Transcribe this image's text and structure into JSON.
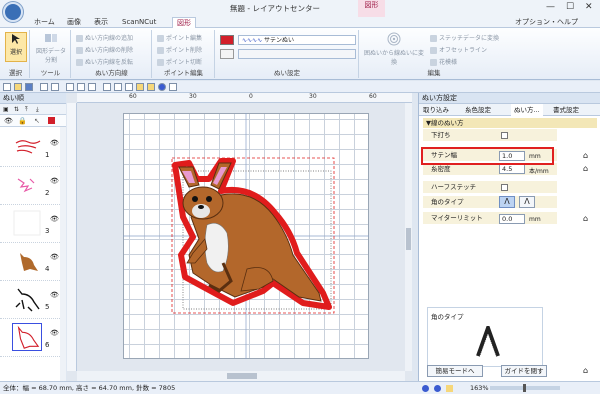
{
  "window": {
    "title": "無題 - レイアウトセンター",
    "context_tab": "図形",
    "minimize": "—",
    "maximize": "☐",
    "close": "✕"
  },
  "menu": {
    "tabs": [
      "ホーム",
      "画像",
      "表示",
      "ScanNCut",
      "図形"
    ],
    "right": "オプション・ヘルプ"
  },
  "ribbon": {
    "select": {
      "label": "選択",
      "group": "選択"
    },
    "tools": {
      "label": "図形データ分割",
      "group": "ツール"
    },
    "direction": {
      "items": [
        "ぬい方向線の追加",
        "ぬい方向線の削除",
        "ぬい方向線を反転"
      ],
      "group": "ぬい方向線"
    },
    "point": {
      "items": [
        "ポイント編集",
        "ポイント削除",
        "ポイント切断"
      ],
      "group": "ポイント編集"
    },
    "sewing": {
      "line_value": "サテンぬい",
      "group": "ぬい設定"
    },
    "edit": {
      "big_label": "囲ぬいから線ぬいに変換",
      "items": [
        "ステッチデータに変換",
        "オフセットライン",
        "花模様"
      ],
      "group": "編集"
    }
  },
  "left_panel": {
    "title": "ぬい順",
    "items": [
      {
        "num": "1"
      },
      {
        "num": "2"
      },
      {
        "num": "3"
      },
      {
        "num": "4"
      },
      {
        "num": "5"
      },
      {
        "num": "6"
      }
    ]
  },
  "ruler": {
    "h_labels": [
      "60",
      "30",
      "0",
      "30",
      "60"
    ]
  },
  "right_panel": {
    "title": "ぬい方設定",
    "tabs": [
      "取り込み",
      "糸色設定",
      "ぬい方...",
      "書式設定"
    ],
    "section": "▼線のぬい方",
    "rows": [
      {
        "label": "下打ち",
        "value": ""
      },
      {
        "label": "サテン幅",
        "value": "1.0",
        "unit": "mm"
      },
      {
        "label": "糸密度",
        "value": "4.5",
        "unit": "本/mm"
      },
      {
        "label": "ハーフステッチ",
        "value": ""
      },
      {
        "label": "角のタイプ",
        "value": ""
      },
      {
        "label": "マイターリミット",
        "value": "0.0",
        "unit": "mm"
      }
    ],
    "preview_title": "角のタイプ",
    "btn_simple": "簡易モードへ",
    "btn_guide": "ガイドを閉す"
  },
  "status": {
    "text": "全体：幅 = 68.70 mm, 高さ = 64.70 mm, 針数 = 7805",
    "zoom": "163%"
  }
}
